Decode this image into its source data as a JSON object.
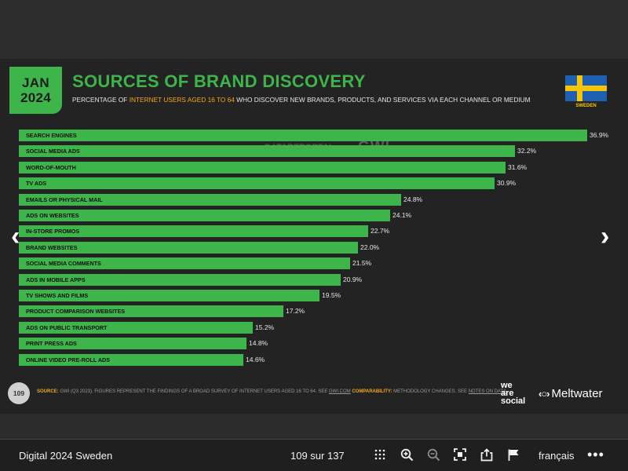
{
  "slide": {
    "date_line1": "JAN",
    "date_line2": "2024",
    "title": "SOURCES OF BRAND DISCOVERY",
    "subtitle_pre": "PERCENTAGE OF ",
    "subtitle_highlight": "INTERNET USERS AGED 16 TO 64",
    "subtitle_post": " WHO DISCOVER NEW BRANDS, PRODUCTS, AND SERVICES VIA EACH CHANNEL OR MEDIUM",
    "country": "SWEDEN",
    "watermark_1": "DATAREPORTAL",
    "watermark_2": "GWI.",
    "page_number": "109",
    "source_label": "SOURCE:",
    "source_text": " GWI (Q3 2023). FIGURES REPRESENT THE FINDINGS OF A BROAD SURVEY OF INTERNET USERS AGED 16 TO 64. SEE ",
    "source_link": "GWI.COM",
    "comparability_label": " COMPARABILITY:",
    "comparability_text": " METHODOLOGY CHANGES. SEE ",
    "notes_link": "NOTES ON DATA",
    "notes_end": ".",
    "brand_was_1": "we",
    "brand_was_2": "are",
    "brand_was_3": "social",
    "brand_mw": "Meltwater",
    "brand_mw_logo": "‹○›"
  },
  "chart_data": {
    "type": "bar",
    "orientation": "horizontal",
    "categories": [
      "SEARCH ENGINES",
      "SOCIAL MEDIA ADS",
      "WORD-OF-MOUTH",
      "TV ADS",
      "EMAILS OR PHYSICAL MAIL",
      "ADS ON WEBSITES",
      "IN-STORE PROMOS",
      "BRAND WEBSITES",
      "SOCIAL MEDIA COMMENTS",
      "ADS IN MOBILE APPS",
      "TV SHOWS AND FILMS",
      "PRODUCT COMPARISON WEBSITES",
      "ADS ON PUBLIC TRANSPORT",
      "PRINT PRESS ADS",
      "ONLINE VIDEO PRE-ROLL ADS"
    ],
    "values": [
      36.9,
      32.2,
      31.6,
      30.9,
      24.8,
      24.1,
      22.7,
      22.0,
      21.5,
      20.9,
      19.5,
      17.2,
      15.2,
      14.8,
      14.6
    ],
    "value_labels": [
      "36.9%",
      "32.2%",
      "31.6%",
      "30.9%",
      "24.8%",
      "24.1%",
      "22.7%",
      "22.0%",
      "21.5%",
      "20.9%",
      "19.5%",
      "17.2%",
      "15.2%",
      "14.8%",
      "14.6%"
    ],
    "bar_color": "#3db54a"
  },
  "viewer": {
    "doc_title": "Digital 2024 Sweden",
    "page_counter": "109 sur 137",
    "language": "français",
    "more": "•••",
    "prev_arrow": "‹",
    "next_arrow": "›"
  },
  "colors": {
    "accent_green": "#3db54a",
    "highlight_orange": "#f5a623",
    "flag_blue": "#1d5fb0",
    "flag_yellow": "#f7c600"
  }
}
